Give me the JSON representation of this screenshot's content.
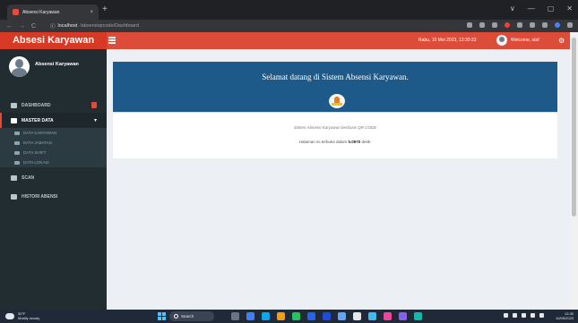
{
  "browser": {
    "tab_title": "Absensi Karyawan",
    "tab_close": "×",
    "new_tab": "+",
    "window_controls": [
      "∨",
      "—",
      "▢",
      "✕"
    ],
    "nav": [
      "←",
      "→",
      "C"
    ],
    "url_host": "localhost",
    "url_path": "/absensiqrcode/Dashboard"
  },
  "header": {
    "logo": "Absesi Karyawan",
    "date": "Rabu, 10 Mei 2023, 13:30:33",
    "welcome": "Welcome, staf"
  },
  "sidebar": {
    "user_name": "Absensi Karyawan",
    "items": [
      {
        "label": "DASHBOARD",
        "icon": "desktop-icon"
      },
      {
        "label": "MASTER DATA",
        "icon": "folder-icon",
        "active": true
      }
    ],
    "subitems": [
      {
        "label": "DATA KARYAWAN",
        "icon": "user-icon"
      },
      {
        "label": "DATA JABATAN",
        "icon": "briefcase-icon"
      },
      {
        "label": "DATA SHIFT",
        "icon": "shuffle-icon"
      },
      {
        "label": "DATA LOKASI",
        "icon": "location-icon"
      }
    ],
    "bottom_items": [
      {
        "label": "SCAN",
        "icon": "camera-icon"
      },
      {
        "label": "HISTORI ABENSI",
        "icon": "edit-icon"
      }
    ]
  },
  "main": {
    "banner_title": "Selamat datang di Sistem Absensi Karyawan.",
    "tagline": "Sistem Absensi Karyawan berbasis QR CODE",
    "render_prefix": "Halaman ini terbuka dalam ",
    "render_time": "0.0970",
    "render_suffix": " detik."
  },
  "taskbar": {
    "temp": "30°F",
    "weather": "Mostly cloudy",
    "search": "Search",
    "time": "13.30",
    "date": "10/05/2023"
  },
  "colors": {
    "header": "#dd4b39",
    "logo_bg": "#d73925",
    "sidebar": "#222d32",
    "banner": "#1d5a8a",
    "content_bg": "#ecf0f5"
  }
}
